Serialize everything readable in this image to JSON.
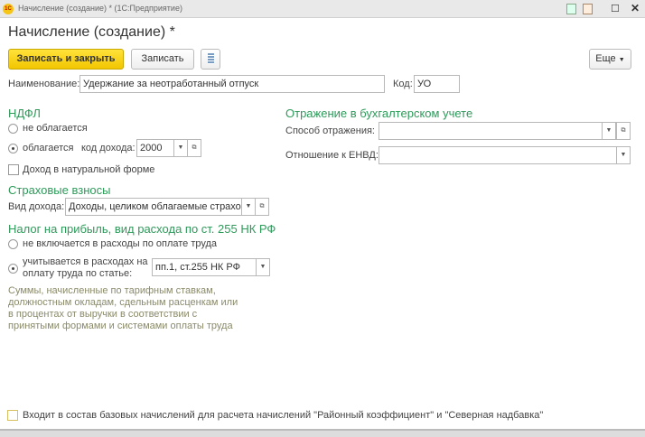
{
  "window": {
    "title": "Начисление (создание) * (1С:Предприятие)",
    "logo": "1С"
  },
  "form": {
    "title": "Начисление (создание) *"
  },
  "toolbar": {
    "save_close": "Записать и закрыть",
    "save": "Записать",
    "more": "Еще"
  },
  "fields": {
    "name_label": "Наименование:",
    "name_value": "Удержание за неотработанный отпуск",
    "code_label": "Код:",
    "code_value": "УО"
  },
  "ndfl": {
    "title": "НДФЛ",
    "not_taxed": "не облагается",
    "taxed": "облагается",
    "income_code_label": "код дохода:",
    "income_code": "2000",
    "in_kind": "Доход в натуральной форме"
  },
  "insurance": {
    "title": "Страховые взносы",
    "income_type_label": "Вид дохода:",
    "income_type": "Доходы, целиком облагаемые страховыми взносами"
  },
  "profit": {
    "title": "Налог на прибыль, вид расхода по ст. 255 НК РФ",
    "not_included": "не включается в расходы по оплате труда",
    "included": "учитывается в расходах на оплату труда по статье:",
    "article": "пп.1, ст.255 НК РФ",
    "note": "Суммы, начисленные по тарифным ставкам, должностным окладам, сдельным расценкам или в процентах от выручки в соответствии с принятыми формами и системами оплаты труда"
  },
  "accounting": {
    "title": "Отражение в бухгалтерском учете",
    "method_label": "Способ отражения:",
    "method_value": "",
    "envd_label": "Отношение к ЕНВД:",
    "envd_value": ""
  },
  "base": {
    "label": "Входит в состав базовых начислений для расчета начислений \"Районный коэффициент\" и \"Северная надбавка\""
  }
}
